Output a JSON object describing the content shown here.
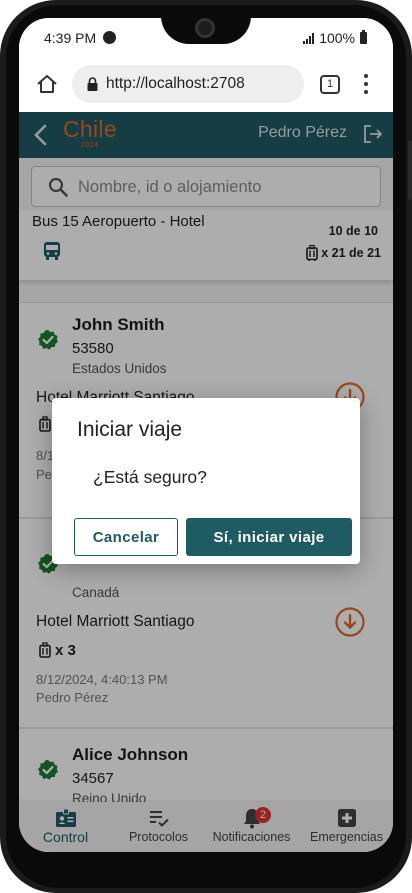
{
  "status_bar": {
    "time": "4:39 PM",
    "battery": "100%"
  },
  "browser": {
    "url": "http://localhost:2708",
    "tab_count": "1"
  },
  "app_header": {
    "logo": "Chile",
    "logo_year": "2024",
    "user": "Pedro Pérez"
  },
  "search": {
    "placeholder": "Nombre, id o alojamiento"
  },
  "trip": {
    "title": "Bus 15 Aeropuerto - Hotel",
    "count": "10 de 10",
    "luggage": "x 21 de 21"
  },
  "passengers": [
    {
      "name": "John Smith",
      "id": "53580",
      "country": "Estados Unidos",
      "hotel": "Hotel Marriott Santiago",
      "luggage": "",
      "date": "8/1",
      "by": "Pe"
    },
    {
      "name": "",
      "id": "",
      "country": "Canadá",
      "hotel": "Hotel Marriott Santiago",
      "luggage": "x 3",
      "date": "8/12/2024, 4:40:13 PM",
      "by": "Pedro Pérez"
    },
    {
      "name": "Alice Johnson",
      "id": "34567",
      "country": "Reino Unido"
    }
  ],
  "bottom_nav": {
    "items": [
      {
        "label": "Control",
        "icon": "id-badge-icon"
      },
      {
        "label": "Protocolos",
        "icon": "checklist-icon"
      },
      {
        "label": "Notificaciones",
        "icon": "bell-icon",
        "badge": "2"
      },
      {
        "label": "Emergencias",
        "icon": "medical-cross-icon"
      }
    ]
  },
  "dialog": {
    "title": "Iniciar viaje",
    "message": "¿Está seguro?",
    "cancel_label": "Cancelar",
    "confirm_label": "Sí, iniciar viaje"
  },
  "colors": {
    "brand_teal": "#1f5b63",
    "accent_orange": "#e06a2c",
    "check_green": "#1e7b34",
    "badge_red": "#d33333"
  }
}
